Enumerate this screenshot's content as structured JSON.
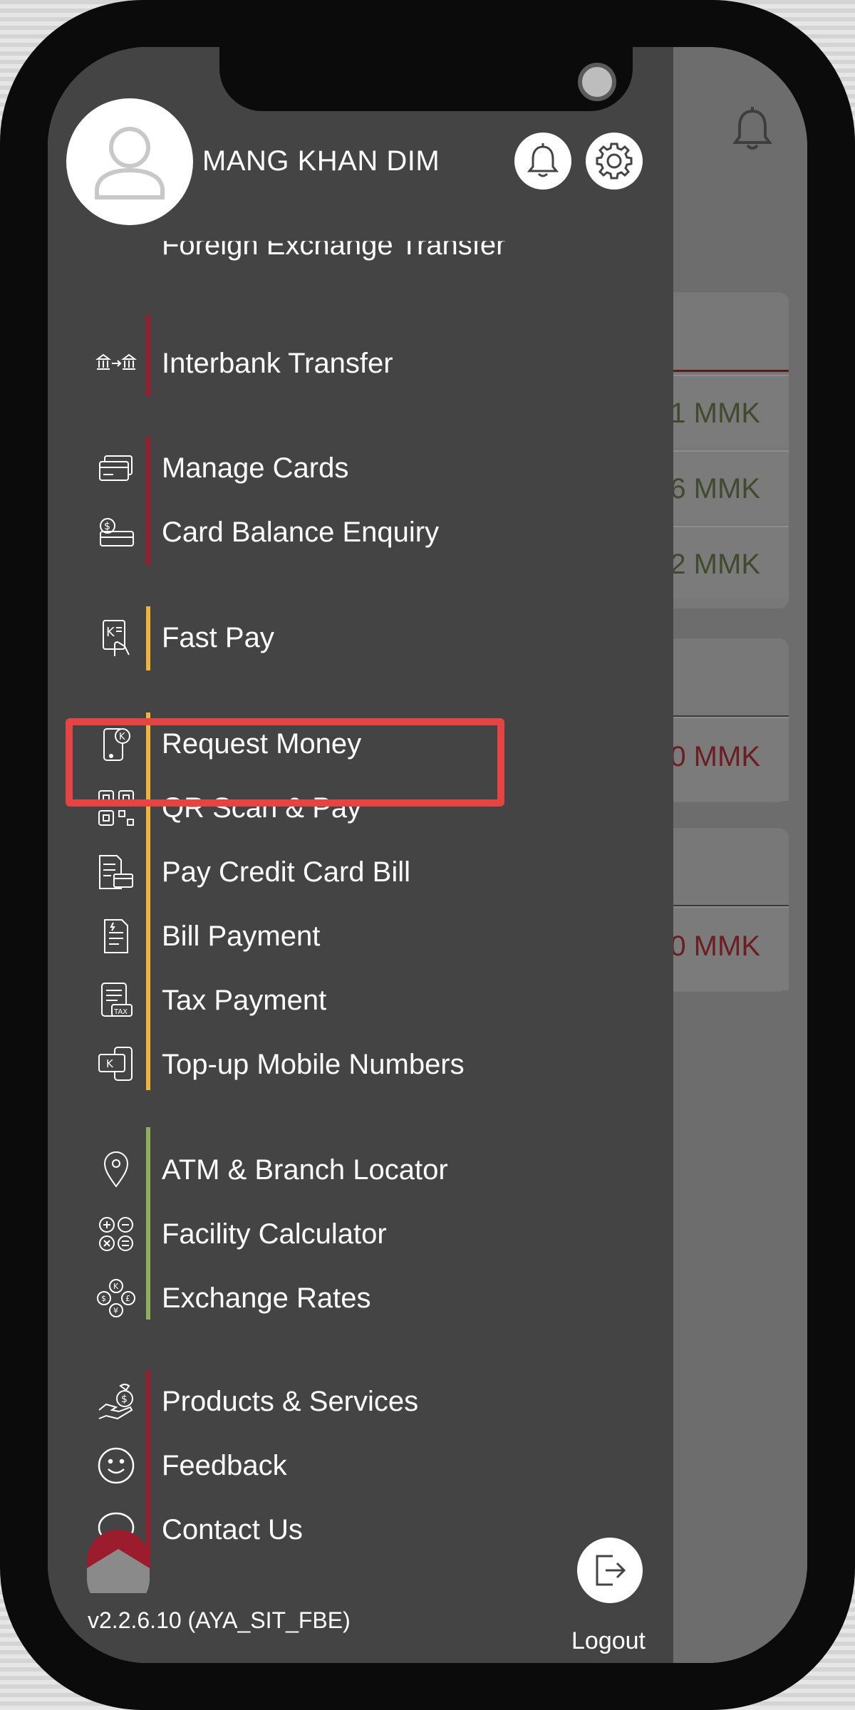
{
  "user": {
    "name": "MANG KHAN DIM"
  },
  "header": {
    "notifications_icon": "bell-icon",
    "settings_icon": "gear-icon"
  },
  "menu": {
    "cut_off_label": "Foreign Exchange Transfer",
    "groups": [
      {
        "accent": "#9b1c2c",
        "items": [
          {
            "label": "Interbank Transfer",
            "icon": "bank-transfer-icon"
          }
        ]
      },
      {
        "accent": "#9b1c2c",
        "items": [
          {
            "label": "Manage Cards",
            "icon": "card-icon"
          },
          {
            "label": "Card Balance Enquiry",
            "icon": "card-balance-icon"
          }
        ]
      },
      {
        "accent": "#f0b43c",
        "items": [
          {
            "label": "Fast Pay",
            "icon": "fast-pay-icon"
          }
        ]
      },
      {
        "accent": "#f0b43c",
        "items": [
          {
            "label": "Request Money",
            "icon": "request-money-icon"
          },
          {
            "label": "QR Scan & Pay",
            "icon": "qr-code-icon"
          },
          {
            "label": "Pay Credit Card Bill",
            "icon": "credit-card-bill-icon"
          },
          {
            "label": "Bill Payment",
            "icon": "bill-icon"
          },
          {
            "label": "Tax Payment",
            "icon": "tax-icon"
          },
          {
            "label": "Top-up Mobile Numbers",
            "icon": "mobile-topup-icon"
          }
        ]
      },
      {
        "accent": "#8fae5e",
        "items": [
          {
            "label": "ATM & Branch Locator",
            "icon": "location-pin-icon"
          },
          {
            "label": "Facility Calculator",
            "icon": "calculator-icon"
          },
          {
            "label": "Exchange Rates",
            "icon": "exchange-rates-icon"
          }
        ]
      },
      {
        "accent": "#9b1c2c",
        "items": [
          {
            "label": "Products & Services",
            "icon": "products-icon"
          },
          {
            "label": "Feedback",
            "icon": "smiley-icon"
          },
          {
            "label": "Contact Us",
            "icon": "chat-bubble-icon"
          }
        ]
      }
    ]
  },
  "highlighted_item": "QR Scan & Pay",
  "footer": {
    "version": "v2.2.6.10 (AYA_SIT_FBE)",
    "logout_label": "Logout"
  },
  "background_amounts": {
    "a1": "1 MMK",
    "a2": "6 MMK",
    "a3": "2 MMK",
    "a4": "0 MMK",
    "a5": "0 MMK"
  },
  "colors": {
    "drawer_bg": "#444444",
    "highlight": "#e34545",
    "brand_red": "#9b1c2c"
  }
}
